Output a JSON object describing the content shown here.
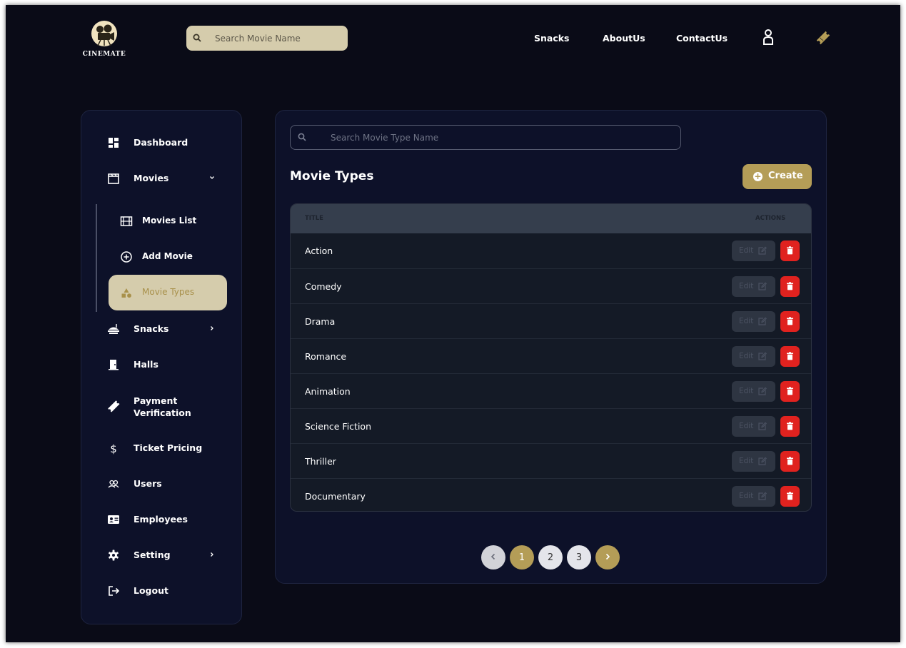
{
  "header": {
    "logo_text": "CINEMATE",
    "search_placeholder": "Search Movie Name",
    "nav_links": [
      "Snacks",
      "AboutUs",
      "ContactUs"
    ],
    "icons": [
      "user-icon",
      "ticket-icon"
    ]
  },
  "sidebar": {
    "items": [
      {
        "label": "Dashboard",
        "icon": "dashboard-icon"
      },
      {
        "label": "Movies",
        "icon": "clapperboard-icon",
        "expanded": true
      },
      {
        "label": "Snacks",
        "icon": "food-tray-icon"
      },
      {
        "label": "Halls",
        "icon": "door-icon"
      },
      {
        "label": "Payment Verification",
        "icon": "ticket-icon"
      },
      {
        "label": "Ticket Pricing",
        "icon": "dollar-icon"
      },
      {
        "label": "Users",
        "icon": "users-icon"
      },
      {
        "label": "Employees",
        "icon": "id-card-icon"
      },
      {
        "label": "Setting",
        "icon": "gear-icon"
      },
      {
        "label": "Logout",
        "icon": "logout-icon"
      }
    ],
    "movies_subitems": [
      {
        "label": "Movies List",
        "icon": "film-icon"
      },
      {
        "label": "Add Movie",
        "icon": "plus-circle-icon"
      },
      {
        "label": "Movie Types",
        "icon": "shapes-icon",
        "active": true
      }
    ]
  },
  "main": {
    "search_placeholder": "Search Movie Type Name",
    "title": "Movie Types",
    "create_label": "Create",
    "table": {
      "columns": [
        "TITLE",
        "ACTIONS"
      ],
      "rows": [
        "Action",
        "Comedy",
        "Drama",
        "Romance",
        "Animation",
        "Science Fiction",
        "Thriller",
        "Documentary"
      ],
      "edit_label": "Edit"
    },
    "pagination": {
      "pages": [
        "1",
        "2",
        "3"
      ],
      "current": "1"
    }
  },
  "colors": {
    "background": "#0a0b17",
    "panel": "#0d1129",
    "accent_gold": "#b49d57",
    "accent_beige": "#d5ccac",
    "delete_red": "#e0221f"
  }
}
